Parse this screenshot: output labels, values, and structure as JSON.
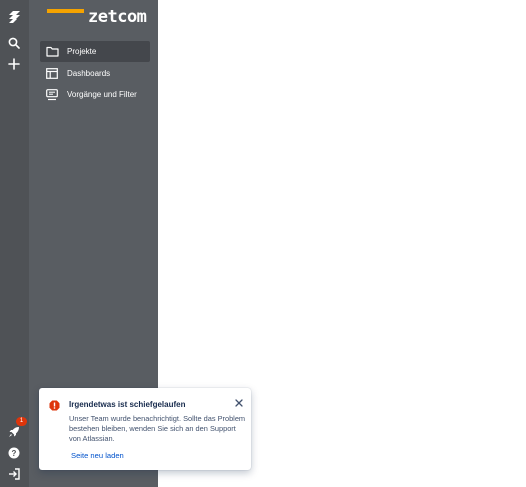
{
  "rail": {
    "items": [
      {
        "icon": "app-switcher-icon",
        "label": ""
      },
      {
        "icon": "search-icon",
        "label": ""
      },
      {
        "icon": "plus-icon",
        "label": ""
      }
    ],
    "bottom": {
      "notifications_icon": "rocket-icon",
      "notifications_count": "1",
      "help_icon": "help-icon",
      "logout_icon": "log-in-icon"
    }
  },
  "sidebar": {
    "logo_text": "zetcom",
    "logo_accent_color": "#f5a300",
    "items": [
      {
        "label": "Projekte",
        "icon": "folder-icon",
        "active": true
      },
      {
        "label": "Dashboards",
        "icon": "dashboard-icon",
        "active": false
      },
      {
        "label": "Vorgänge und Filter",
        "icon": "issues-filter-icon",
        "active": false
      }
    ]
  },
  "flag": {
    "title": "Irgendetwas ist schiefgelaufen",
    "body": "Unser Team wurde benachrichtigt. Sollte das Problem bestehen bleiben, wenden Sie sich an den Support von Atlassian.",
    "action": "Seite neu laden",
    "icon": "error-icon",
    "close_icon": "close-icon",
    "error_color": "#de350b",
    "link_color": "#0052cc"
  }
}
